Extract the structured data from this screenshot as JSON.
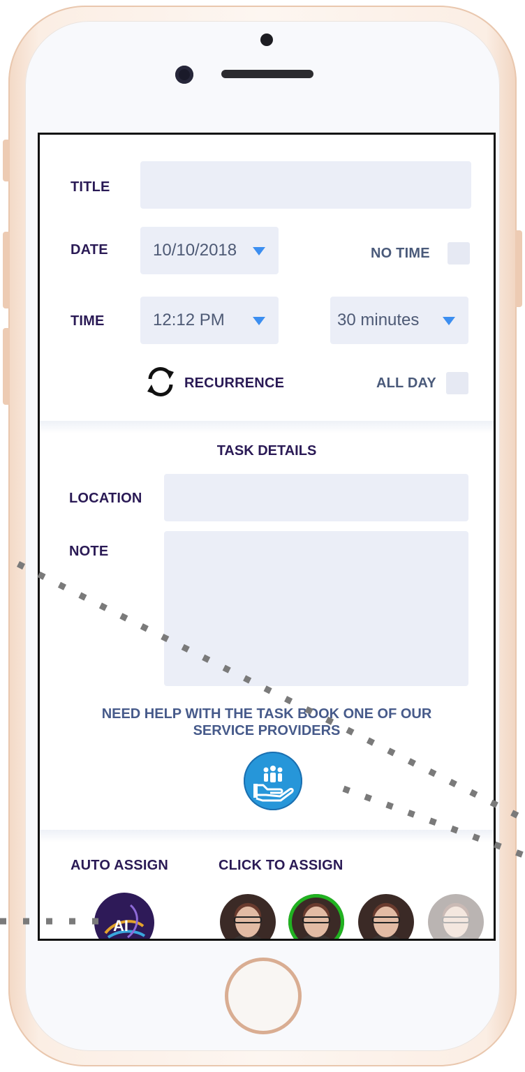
{
  "form": {
    "title_label": "TITLE",
    "title_value": "",
    "date_label": "DATE",
    "date_value": "10/10/2018",
    "no_time_label": "NO TIME",
    "time_label": "TIME",
    "time_value": "12:12 PM",
    "duration_value": "30 minutes",
    "recurrence_label": "RECURRENCE",
    "all_day_label": "ALL DAY"
  },
  "task_details": {
    "heading": "TASK DETAILS",
    "location_label": "LOCATION",
    "location_value": "",
    "note_label": "NOTE",
    "note_value": "",
    "help_line1": "NEED HELP WITH THE TASK BOOK ONE OF OUR",
    "help_line2": "SERVICE PROVIDERS"
  },
  "assign": {
    "auto_assign_label": "AUTO ASSIGN",
    "click_to_assign_label": "CLICK TO ASSIGN",
    "ai_logo_text": "AI",
    "selected_avatar_index": 1,
    "accent_color": "#21b321"
  },
  "icons": {
    "recurrence": "refresh-icon",
    "help": "service-provider-icon",
    "dropdown": "caret-down-icon"
  },
  "colors": {
    "label": "#2a1a55",
    "field_bg": "#ebeef7",
    "accent_blue": "#3c8ef0",
    "help_button": "#2696d9"
  }
}
